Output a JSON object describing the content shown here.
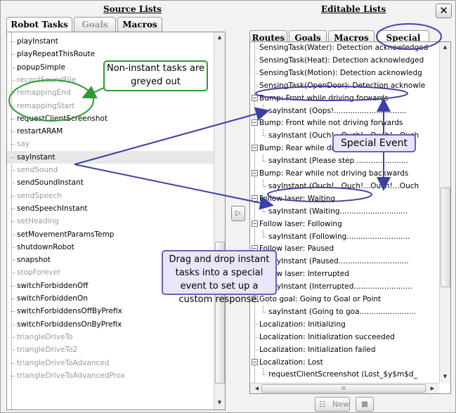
{
  "window": {
    "close_label": "✕"
  },
  "source": {
    "title": "Source Lists",
    "tabs": [
      {
        "label": "Robot Tasks",
        "state": "active"
      },
      {
        "label": "Goals",
        "state": "disabled"
      },
      {
        "label": "Macros",
        "state": "normal"
      }
    ],
    "items": [
      {
        "label": "playInstant",
        "grey": false
      },
      {
        "label": "playRepeatThisRoute",
        "grey": false
      },
      {
        "label": "popupSimple",
        "grey": false
      },
      {
        "label": "recordSoundFile",
        "grey": true
      },
      {
        "label": "remappingEnd",
        "grey": true
      },
      {
        "label": "remappingStart",
        "grey": true
      },
      {
        "label": "requestClientScreenshot",
        "grey": false
      },
      {
        "label": "restartARAM",
        "grey": false
      },
      {
        "label": "say",
        "grey": true
      },
      {
        "label": "sayInstant",
        "grey": false,
        "selected": true
      },
      {
        "label": "sendSound",
        "grey": true
      },
      {
        "label": "sendSoundInstant",
        "grey": false
      },
      {
        "label": "sendSpeech",
        "grey": true
      },
      {
        "label": "sendSpeechInstant",
        "grey": false
      },
      {
        "label": "setHeading",
        "grey": true
      },
      {
        "label": "setMovementParamsTemp",
        "grey": false
      },
      {
        "label": "shutdownRobot",
        "grey": false
      },
      {
        "label": "snapshot",
        "grey": false
      },
      {
        "label": "stopForever",
        "grey": true
      },
      {
        "label": "switchForbiddenOff",
        "grey": false
      },
      {
        "label": "switchForbiddenOn",
        "grey": false
      },
      {
        "label": "switchForbiddensOffByPrefix",
        "grey": false
      },
      {
        "label": "switchForbiddensOnByPrefix",
        "grey": false
      },
      {
        "label": "triangleDriveTo",
        "grey": true
      },
      {
        "label": "triangleDriveTo2",
        "grey": true
      },
      {
        "label": "triangleDriveToAdvanced",
        "grey": true
      },
      {
        "label": "triangleDriveToAdvancedProx",
        "grey": true
      }
    ]
  },
  "editable": {
    "title": "Editable Lists",
    "tabs": [
      {
        "label": "Routes",
        "state": "normal"
      },
      {
        "label": "Goals",
        "state": "normal"
      },
      {
        "label": "Macros",
        "state": "normal"
      },
      {
        "label": "Special",
        "state": "active"
      }
    ],
    "items": [
      {
        "label": "SensingTask(Water): Detection acknowledged",
        "level": 0
      },
      {
        "label": "SensingTask(Heat): Detection acknowledged",
        "level": 0
      },
      {
        "label": "SensingTask(Motion): Detection acknowledg",
        "level": 0
      },
      {
        "label": "SensingTask(OpenDoor): Detection acknowle",
        "level": 0
      },
      {
        "label": "Bump: Front while driving forwards",
        "level": 0,
        "parent": true
      },
      {
        "label": "sayInstant (Oops!...............................",
        "level": 1
      },
      {
        "label": "Bump: Front while not driving forwards",
        "level": 0,
        "parent": true
      },
      {
        "label": "sayInstant (Ouch!...Ouch!...Ouch!...Ouch",
        "level": 1
      },
      {
        "label": "Bump: Rear while driving backwards",
        "level": 0,
        "parent": true
      },
      {
        "label": "sayInstant (Please step ......................",
        "level": 1
      },
      {
        "label": "Bump: Rear while not driving backwards",
        "level": 0,
        "parent": true
      },
      {
        "label": "sayInstant (Ouch!...Ouch!...Ouch!...Ouch",
        "level": 1
      },
      {
        "label": "Follow laser: Waiting",
        "level": 0,
        "parent": true
      },
      {
        "label": "sayInstant (Waiting.............................",
        "level": 1
      },
      {
        "label": "Follow laser: Following",
        "level": 0,
        "parent": true
      },
      {
        "label": "sayInstant (Following...........................",
        "level": 1
      },
      {
        "label": "Follow laser: Paused",
        "level": 0,
        "parent": true
      },
      {
        "label": "sayInstant (Paused..............................",
        "level": 1
      },
      {
        "label": "Follow laser: Interrupted",
        "level": 0,
        "parent": true
      },
      {
        "label": "sayInstant (Interrupted.........................",
        "level": 1
      },
      {
        "label": "Goto goal: Going to Goal or Point",
        "level": 0,
        "parent": true
      },
      {
        "label": "sayInstant (Going to goa........................",
        "level": 1
      },
      {
        "label": "Localization: Initializing",
        "level": 0
      },
      {
        "label": "Localization: Initialization succeeded",
        "level": 0
      },
      {
        "label": "Localization: Initialization failed",
        "level": 0
      },
      {
        "label": "Localization: Lost",
        "level": 0,
        "parent": true
      },
      {
        "label": "requestClientScreenshot (Lost_$y$m$d_",
        "level": 1
      }
    ],
    "hscroll_grip": "III"
  },
  "callouts": {
    "greyed": "Non-instant tasks are greyed out",
    "special": "Special Event",
    "drag": "Drag and drop instant tasks into a special event to set up a custom response."
  },
  "bottom": {
    "new_label": "New"
  },
  "icons": {
    "close": "close-icon",
    "transfer": "arrow-right-icon",
    "new": "new-task-icon",
    "delete": "delete-icon"
  },
  "colors": {
    "callout_border": "#4a3fa3",
    "green_callout": "#2f9a34",
    "arrow": "#3b40a8"
  }
}
